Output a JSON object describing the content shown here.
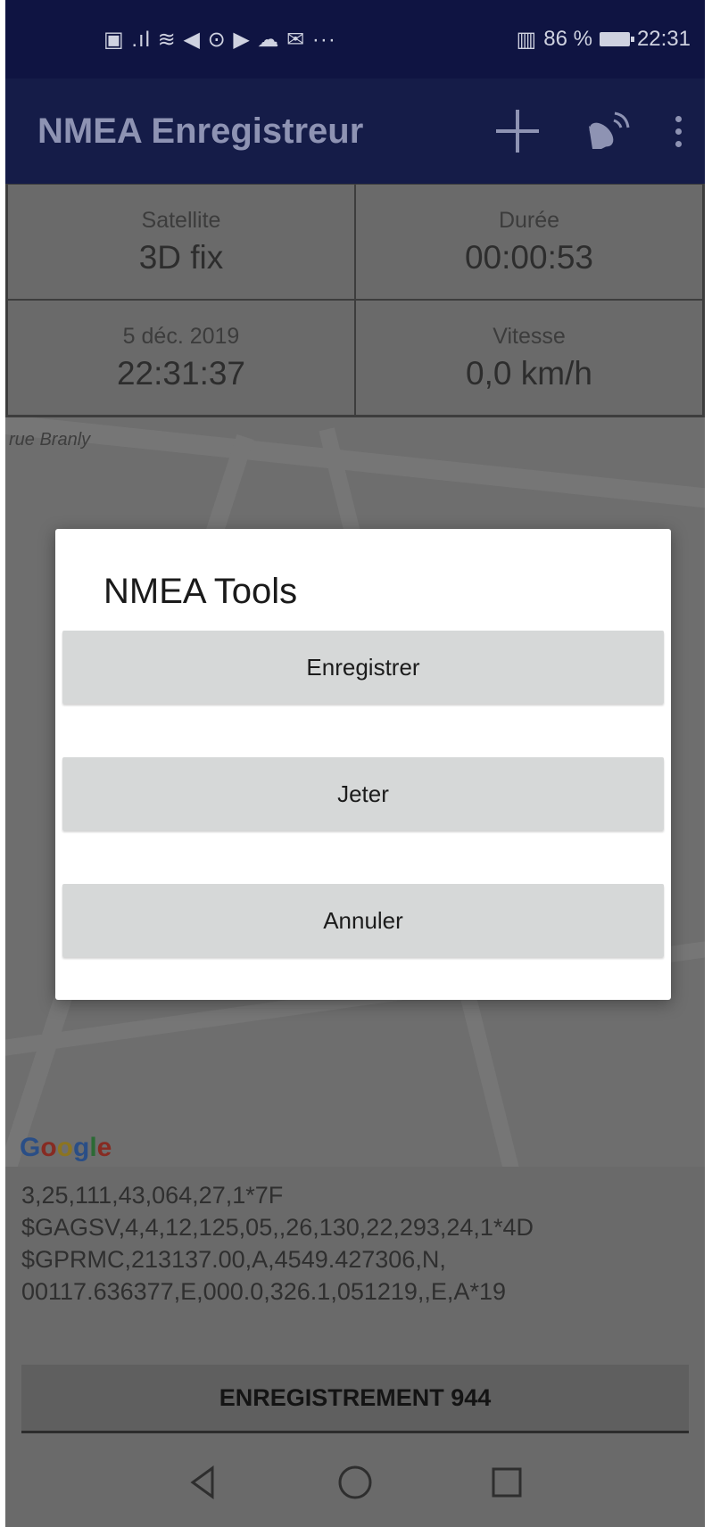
{
  "status_bar": {
    "left_icons": "▣ .ıl ≋ ◀ ⊙ ▶ ☁ ✉ ···",
    "sim_icon": "▥",
    "battery_percent": "86 %",
    "time": "22:31"
  },
  "app_bar": {
    "title": "NMEA Enregistreur",
    "icons": [
      "plus-icon",
      "satellite-dish-icon",
      "more-vert-icon"
    ]
  },
  "info": {
    "satellite_label": "Satellite",
    "satellite_value": "3D fix",
    "duration_label": "Durée",
    "duration_value": "00:00:53",
    "date_label": "5 déc. 2019",
    "time_value": "22:31:37",
    "speed_label": "Vitesse",
    "speed_value": "0,0 km/h"
  },
  "map": {
    "street_label": "rue Branly",
    "logo_letters": [
      "G",
      "o",
      "o",
      "g",
      "l",
      "e"
    ]
  },
  "log": {
    "lines": [
      "3,25,111,43,064,27,1*7F",
      "$GAGSV,4,4,12,125,05,,26,130,22,293,24,1*4D",
      "$GPRMC,213137.00,A,4549.427306,N,",
      "00117.636377,E,000.0,326.1,051219,,E,A*19"
    ]
  },
  "record_button": {
    "label": "ENREGISTREMENT 944"
  },
  "dialog": {
    "title": "NMEA Tools",
    "save_label": "Enregistrer",
    "discard_label": "Jeter",
    "cancel_label": "Annuler"
  },
  "nav_bar": {
    "icons": [
      "back-icon",
      "home-icon",
      "recents-icon"
    ]
  },
  "colors": {
    "app_bar": "#151c48",
    "status_bar": "#0f1442",
    "dialog_button": "#d6d8d8",
    "scrim": "#6a6a6a"
  }
}
